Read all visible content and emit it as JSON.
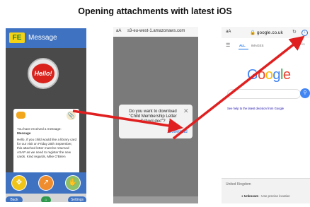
{
  "title": "Opening attachments with latest iOS",
  "panel1": {
    "header_title": "Message",
    "logo_text": "FE",
    "hello_text": "Hello!",
    "message_heading": "You have received a message:",
    "message_label": "Message",
    "message_body": "Hello, if you child would like a library card for our visit on Friday 20th September, this attached letter must be returned ASAP as we need to register the new cards. Kind regards, Mike O'Brien",
    "nav_back": "Back",
    "nav_settings": "Settings"
  },
  "panel2": {
    "aa": "aA",
    "url": "s3-eu-west-1.amazonaws.com",
    "dialog_question": "Do you want to download \"Child Membership Letter School.doc\"?",
    "download_label": "Download"
  },
  "panel3": {
    "aa": "aA",
    "url": "google.co.uk",
    "tab_all": "ALL",
    "tab_images": "IMAGES",
    "sign_in": "Sign in",
    "google_logo": "Google",
    "covid_link": "See help to the latest decision from Google",
    "region": "United Kingdom",
    "location_bold": "Unknown",
    "location_rest": " - Use precise location"
  },
  "colors": {
    "accent_blue": "#3f73c2",
    "arrow_red": "#e02020"
  }
}
